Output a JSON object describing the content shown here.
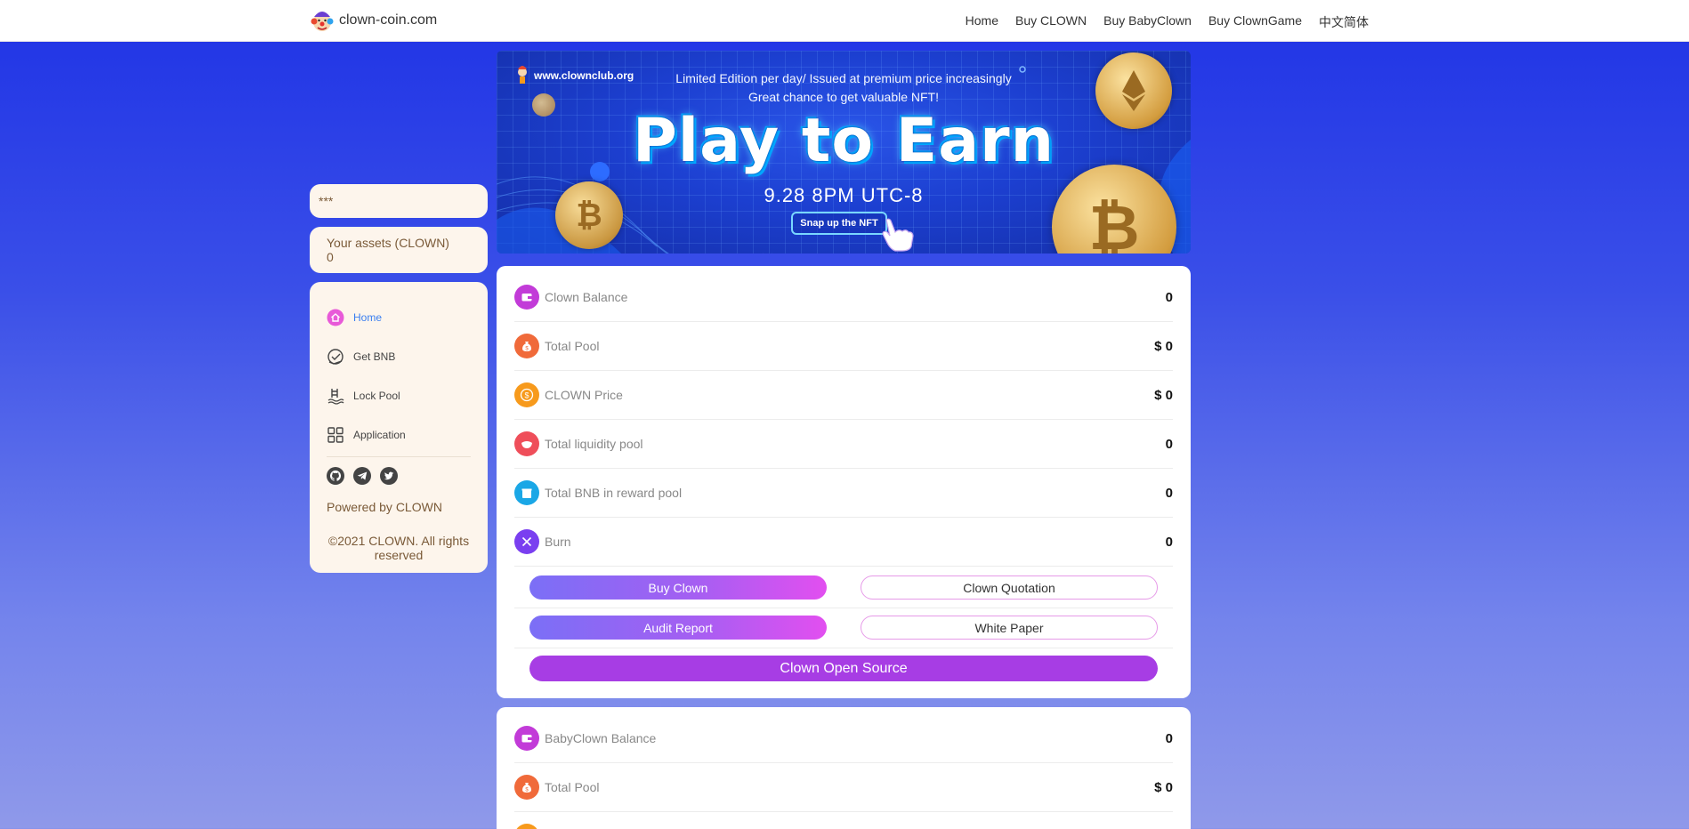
{
  "header": {
    "site_name": "clown-coin.com",
    "nav": [
      "Home",
      "Buy CLOWN",
      "Buy BabyClown",
      "Buy ClownGame",
      "中文简体"
    ]
  },
  "sidebar": {
    "address_value": "***",
    "assets_label": "Your assets (CLOWN)",
    "assets_value": "0",
    "menu": [
      {
        "label": "Home",
        "icon": "home-icon",
        "active": true
      },
      {
        "label": "Get BNB",
        "icon": "bnb-faucet-icon"
      },
      {
        "label": "Lock Pool",
        "icon": "pool-ladder-icon"
      },
      {
        "label": "Application",
        "icon": "apps-grid-icon"
      }
    ],
    "socials": [
      "github-icon",
      "telegram-icon",
      "twitter-icon"
    ],
    "powered": "Powered by CLOWN",
    "copyright": "©2021 CLOWN. All rights reserved"
  },
  "banner": {
    "site": "www.clownclub.org",
    "line1": "Limited Edition per day/ Issued at premium price increasingly",
    "line2": "Great chance to get valuable NFT!",
    "title": "Play to Earn",
    "date": "9.28 8PM UTC-8",
    "button": "Snap up the NFT"
  },
  "stats": [
    {
      "label": "Clown Balance",
      "value": "0",
      "icon": "wallet-icon",
      "color": "#c23bd8"
    },
    {
      "label": "Total Pool",
      "value": "$ 0",
      "icon": "money-bag-icon",
      "color": "#f06a3a"
    },
    {
      "label": "CLOWN Price",
      "value": "$ 0",
      "icon": "dollar-coin-icon",
      "color": "#f79a1c"
    },
    {
      "label": "Total liquidity pool",
      "value": "0",
      "icon": "liquidity-icon",
      "color": "#ef4e5a"
    },
    {
      "label": "Total BNB in reward pool",
      "value": "0",
      "icon": "gift-box-icon",
      "color": "#1aa7e6"
    },
    {
      "label": "Burn",
      "value": "0",
      "icon": "burn-x-icon",
      "color": "#7a3ff0"
    }
  ],
  "buttons": {
    "buy_clown": "Buy Clown",
    "clown_quotation": "Clown Quotation",
    "audit_report": "Audit Report",
    "white_paper": "White Paper",
    "open_source": "Clown Open Source"
  },
  "stats2": [
    {
      "label": "BabyClown Balance",
      "value": "0",
      "icon": "wallet-icon",
      "color": "#c23bd8"
    },
    {
      "label": "Total Pool",
      "value": "$ 0",
      "icon": "money-bag-icon",
      "color": "#f06a3a"
    }
  ]
}
